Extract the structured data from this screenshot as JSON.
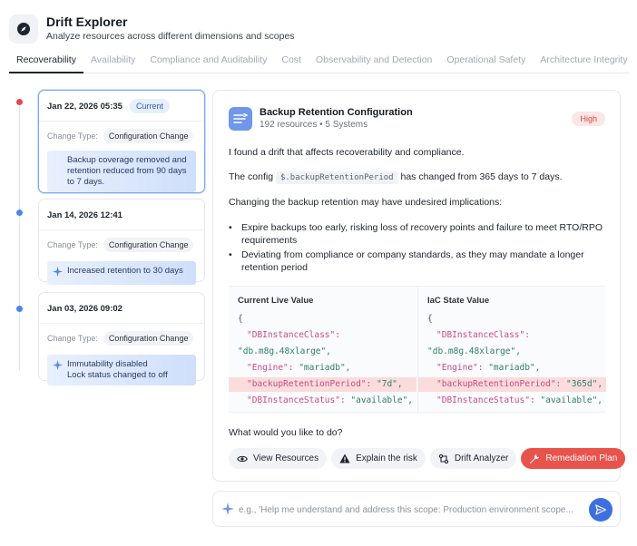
{
  "app": {
    "title": "Drift Explorer",
    "subtitle": "Analyze resources across different dimensions and scopes",
    "logo_icon": "compass-icon"
  },
  "tabs": [
    {
      "label": "Recoverability",
      "active": true
    },
    {
      "label": "Availability",
      "active": false
    },
    {
      "label": "Compliance and Auditability",
      "active": false
    },
    {
      "label": "Cost",
      "active": false
    },
    {
      "label": "Observability and Detection",
      "active": false
    },
    {
      "label": "Operational Safety",
      "active": false
    },
    {
      "label": "Architecture Integrity",
      "active": false
    }
  ],
  "timeline": {
    "type_label": "Change Type:",
    "events": [
      {
        "date": "Jan 22, 2026 05:35",
        "badge": "Current",
        "change_type": "Configuration Change",
        "summary": "Backup coverage removed and retention reduced from 90 days to 7 days.",
        "dot_color": "#e5484d",
        "selected": true
      },
      {
        "date": "Jan 14, 2026 12:41",
        "badge": "",
        "change_type": "Configuration Change",
        "summary": "Increased retention to 30 days",
        "dot_color": "#4a86e8",
        "selected": false
      },
      {
        "date": "Jan 03, 2026 09:02",
        "badge": "",
        "change_type": "Configuration Change",
        "summary": "Immutability disabled\nLock status changed to off",
        "dot_color": "#4a86e8",
        "selected": false
      }
    ]
  },
  "detail": {
    "resource_title": "Backup Retention Configuration",
    "resource_meta": "192 resources • 5 Systems",
    "severity": "High",
    "intro": "I found a drift that affects recoverability and compliance.",
    "config_prefix": "The config",
    "config_key": "$.backupRetentionPeriod",
    "config_suffix": "has changed from 365 days to 7 days.",
    "implications": "Changing the backup retention may have undesired implications:",
    "bullets": [
      "Expire backups too early, risking loss of recovery points and failure to meet RTO/RPO requirements",
      "Deviating from compliance or company standards, as they may mandate a longer retention period"
    ],
    "diff": {
      "left_title": "Current Live Value",
      "right_title": "IaC State Value",
      "left_lines": [
        {
          "key": "",
          "value": "{",
          "hl": false
        },
        {
          "key": "\"DBInstanceClass\":",
          "value": "",
          "hl": false
        },
        {
          "key": "",
          "value": "\"db.m8g.48xlarge\",",
          "hl": false
        },
        {
          "key": "\"Engine\":",
          "value": " \"mariadb\",",
          "hl": false
        },
        {
          "key": "\"backupRetentionPeriod\":",
          "value": " \"7d\",",
          "hl": true
        },
        {
          "key": "\"DBInstanceStatus\":",
          "value": " \"available\",",
          "hl": false
        }
      ],
      "right_lines": [
        {
          "key": "",
          "value": "{",
          "hl": false
        },
        {
          "key": "\"DBInstanceClass\":",
          "value": "",
          "hl": false
        },
        {
          "key": "",
          "value": "\"db.m8g.48xlarge\",",
          "hl": false
        },
        {
          "key": "\"Engine\":",
          "value": " \"mariadb\",",
          "hl": false
        },
        {
          "key": "\"backupRetentionPeriod\":",
          "value": " \"365d\",",
          "hl": true
        },
        {
          "key": "\"DBInstanceStatus\":",
          "value": " \"available\",",
          "hl": false
        }
      ]
    },
    "question": "What would you like to do?",
    "actions": [
      {
        "label": "View Resources",
        "icon": "eye-icon"
      },
      {
        "label": "Explain the risk",
        "icon": "warning-icon"
      },
      {
        "label": "Drift Analyzer",
        "icon": "analyzer-icon"
      },
      {
        "label": "Remediation Plan",
        "icon": "wrench-icon"
      }
    ]
  },
  "chat": {
    "placeholder": "e.g., 'Help me understand and address this scope: Production environment scope...",
    "send_icon": "send-icon"
  },
  "colors": {
    "accent": "#3d6fe0",
    "danger": "#e9534c",
    "severity_bg": "#fde6e6"
  }
}
